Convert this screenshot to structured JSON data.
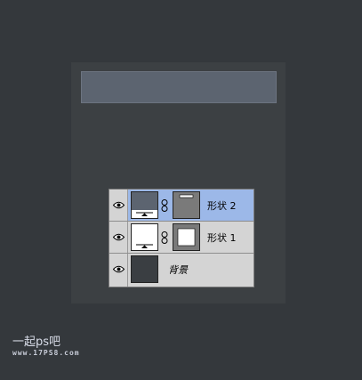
{
  "layers": [
    {
      "name": "形状 2",
      "selected": true,
      "thumb_color": "#5c6470",
      "has_mask": true,
      "mask_variant": "line"
    },
    {
      "name": "形状 1",
      "selected": false,
      "thumb_color": "#ffffff",
      "has_mask": true,
      "mask_variant": "box"
    },
    {
      "name": "背景",
      "selected": false,
      "thumb_color": "#3a3e42",
      "has_mask": false
    }
  ],
  "colors": {
    "background": "#34383c",
    "canvas": "#3c4043",
    "banner": "#5c6470",
    "selected_row": "#9cb8e8"
  },
  "watermark": {
    "line1": "一起ps吧",
    "line2": "www.17PS8.com"
  }
}
